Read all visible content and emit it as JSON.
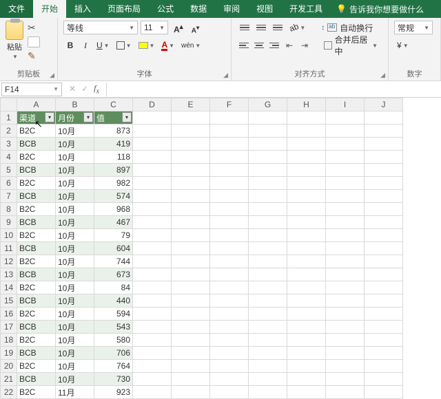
{
  "menu": {
    "file": "文件",
    "home": "开始",
    "insert": "插入",
    "pageLayout": "页面布局",
    "formulas": "公式",
    "data": "数据",
    "review": "审阅",
    "view": "视图",
    "dev": "开发工具",
    "tellMe": "告诉我你想要做什么"
  },
  "ribbon": {
    "clipboard": {
      "paste": "粘贴",
      "label": "剪贴板"
    },
    "font": {
      "name": "等线",
      "size": "11",
      "bold": "B",
      "italic": "I",
      "underline": "U",
      "letterA": "A",
      "label": "字体"
    },
    "align": {
      "wrap": "自动换行",
      "merge": "合并后居中",
      "label": "对齐方式"
    },
    "number": {
      "format": "常规",
      "label": "数字"
    }
  },
  "nameBox": "F14",
  "formula": "",
  "columns": [
    "A",
    "B",
    "C",
    "D",
    "E",
    "F",
    "G",
    "H",
    "I",
    "J"
  ],
  "headers": {
    "a": "渠道",
    "b": "月份",
    "c": "值"
  },
  "rows": [
    {
      "a": "B2C",
      "b": "10月",
      "c": 873,
      "band": false
    },
    {
      "a": "BCB",
      "b": "10月",
      "c": 419,
      "band": true
    },
    {
      "a": "B2C",
      "b": "10月",
      "c": 118,
      "band": false
    },
    {
      "a": "BCB",
      "b": "10月",
      "c": 897,
      "band": true
    },
    {
      "a": "B2C",
      "b": "10月",
      "c": 982,
      "band": false
    },
    {
      "a": "BCB",
      "b": "10月",
      "c": 574,
      "band": true
    },
    {
      "a": "B2C",
      "b": "10月",
      "c": 968,
      "band": false
    },
    {
      "a": "BCB",
      "b": "10月",
      "c": 467,
      "band": true
    },
    {
      "a": "B2C",
      "b": "10月",
      "c": 79,
      "band": false
    },
    {
      "a": "BCB",
      "b": "10月",
      "c": 604,
      "band": true
    },
    {
      "a": "B2C",
      "b": "10月",
      "c": 744,
      "band": false
    },
    {
      "a": "BCB",
      "b": "10月",
      "c": 673,
      "band": true
    },
    {
      "a": "B2C",
      "b": "10月",
      "c": 84,
      "band": false
    },
    {
      "a": "BCB",
      "b": "10月",
      "c": 440,
      "band": true
    },
    {
      "a": "B2C",
      "b": "10月",
      "c": 594,
      "band": false
    },
    {
      "a": "BCB",
      "b": "10月",
      "c": 543,
      "band": true
    },
    {
      "a": "B2C",
      "b": "10月",
      "c": 580,
      "band": false
    },
    {
      "a": "BCB",
      "b": "10月",
      "c": 706,
      "band": true
    },
    {
      "a": "B2C",
      "b": "10月",
      "c": 764,
      "band": false
    },
    {
      "a": "BCB",
      "b": "10月",
      "c": 730,
      "band": true
    },
    {
      "a": "B2C",
      "b": "11月",
      "c": 923,
      "band": false
    }
  ]
}
